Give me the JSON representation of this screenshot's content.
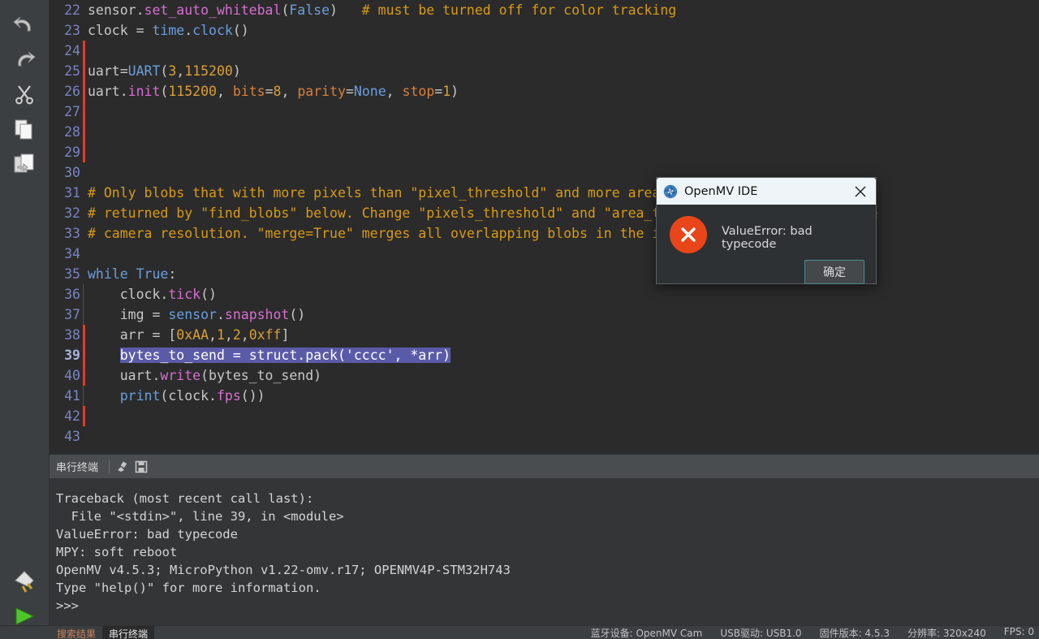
{
  "toolbar": {
    "items": [
      {
        "name": "undo-icon",
        "label": "Undo"
      },
      {
        "name": "redo-icon",
        "label": "Redo"
      },
      {
        "name": "cut-icon",
        "label": "Cut"
      },
      {
        "name": "copy-icon",
        "label": "Copy"
      },
      {
        "name": "paste-icon",
        "label": "Paste"
      }
    ],
    "bottom_items": [
      {
        "name": "connect-plug-icon",
        "label": "Connect"
      },
      {
        "name": "run-play-icon",
        "label": "Run"
      }
    ]
  },
  "editor": {
    "current_line": 39,
    "lines": [
      {
        "n": 22,
        "changed": false,
        "tokens": [
          {
            "t": "sensor",
            "c": "t-plain"
          },
          {
            "t": ".",
            "c": "t-plain"
          },
          {
            "t": "set_auto_whitebal",
            "c": "t-fn"
          },
          {
            "t": "(",
            "c": "t-plain"
          },
          {
            "t": "False",
            "c": "t-kw"
          },
          {
            "t": ")",
            "c": "t-plain"
          },
          {
            "t": "   # must be turned off for color tracking",
            "c": "t-com"
          }
        ]
      },
      {
        "n": 23,
        "changed": false,
        "tokens": [
          {
            "t": "clock = ",
            "c": "t-plain"
          },
          {
            "t": "time",
            "c": "t-builtin"
          },
          {
            "t": ".",
            "c": "t-plain"
          },
          {
            "t": "clock",
            "c": "t-builtin"
          },
          {
            "t": "()",
            "c": "t-plain"
          }
        ]
      },
      {
        "n": 24,
        "changed": true,
        "tokens": []
      },
      {
        "n": 25,
        "changed": true,
        "tokens": [
          {
            "t": "uart=",
            "c": "t-plain"
          },
          {
            "t": "UART",
            "c": "t-builtin"
          },
          {
            "t": "(",
            "c": "t-plain"
          },
          {
            "t": "3",
            "c": "t-num"
          },
          {
            "t": ",",
            "c": "t-plain"
          },
          {
            "t": "115200",
            "c": "t-num"
          },
          {
            "t": ")",
            "c": "t-plain"
          }
        ]
      },
      {
        "n": 26,
        "changed": true,
        "tokens": [
          {
            "t": "uart.",
            "c": "t-plain"
          },
          {
            "t": "init",
            "c": "t-fn"
          },
          {
            "t": "(",
            "c": "t-plain"
          },
          {
            "t": "115200",
            "c": "t-num"
          },
          {
            "t": ", ",
            "c": "t-plain"
          },
          {
            "t": "bits",
            "c": "t-param"
          },
          {
            "t": "=",
            "c": "t-plain"
          },
          {
            "t": "8",
            "c": "t-num"
          },
          {
            "t": ", ",
            "c": "t-plain"
          },
          {
            "t": "parity",
            "c": "t-param"
          },
          {
            "t": "=",
            "c": "t-plain"
          },
          {
            "t": "None",
            "c": "t-kw"
          },
          {
            "t": ", ",
            "c": "t-plain"
          },
          {
            "t": "stop",
            "c": "t-param"
          },
          {
            "t": "=",
            "c": "t-plain"
          },
          {
            "t": "1",
            "c": "t-num"
          },
          {
            "t": ")",
            "c": "t-plain"
          }
        ]
      },
      {
        "n": 27,
        "changed": true,
        "tokens": []
      },
      {
        "n": 28,
        "changed": true,
        "tokens": []
      },
      {
        "n": 29,
        "changed": true,
        "tokens": []
      },
      {
        "n": 30,
        "changed": false,
        "tokens": []
      },
      {
        "n": 31,
        "changed": false,
        "tokens": [
          {
            "t": "# Only blobs that with more pixels than \"pixel_threshold\" and more area than \"area_threshold\" are",
            "c": "t-com"
          }
        ]
      },
      {
        "n": 32,
        "changed": false,
        "tokens": [
          {
            "t": "# returned by \"find_blobs\" below. Change \"pixels_threshold\" and \"area_threshold\" if you change the",
            "c": "t-com"
          }
        ]
      },
      {
        "n": 33,
        "changed": false,
        "tokens": [
          {
            "t": "# camera resolution. \"merge=True\" merges all overlapping blobs in the image.",
            "c": "t-com"
          }
        ]
      },
      {
        "n": 34,
        "changed": false,
        "tokens": []
      },
      {
        "n": 35,
        "changed": false,
        "tokens": [
          {
            "t": "while",
            "c": "t-kw"
          },
          {
            "t": " ",
            "c": "t-plain"
          },
          {
            "t": "True",
            "c": "t-kw"
          },
          {
            "t": ":",
            "c": "t-plain"
          }
        ]
      },
      {
        "n": 36,
        "changed": false,
        "guide": true,
        "tokens": [
          {
            "t": "    clock.",
            "c": "t-plain"
          },
          {
            "t": "tick",
            "c": "t-fn"
          },
          {
            "t": "()",
            "c": "t-plain"
          }
        ]
      },
      {
        "n": 37,
        "changed": false,
        "guide": true,
        "tokens": [
          {
            "t": "    img = ",
            "c": "t-plain"
          },
          {
            "t": "sensor",
            "c": "t-builtin"
          },
          {
            "t": ".",
            "c": "t-plain"
          },
          {
            "t": "snapshot",
            "c": "t-fn"
          },
          {
            "t": "()",
            "c": "t-plain"
          }
        ]
      },
      {
        "n": 38,
        "changed": true,
        "guide": true,
        "tokens": [
          {
            "t": "    arr = [",
            "c": "t-plain"
          },
          {
            "t": "0xAA",
            "c": "t-num"
          },
          {
            "t": ",",
            "c": "t-plain"
          },
          {
            "t": "1",
            "c": "t-num"
          },
          {
            "t": ",",
            "c": "t-plain"
          },
          {
            "t": "2",
            "c": "t-num"
          },
          {
            "t": ",",
            "c": "t-plain"
          },
          {
            "t": "0xff",
            "c": "t-num"
          },
          {
            "t": "]",
            "c": "t-plain"
          }
        ]
      },
      {
        "n": 39,
        "changed": true,
        "guide": true,
        "selected": true,
        "tokens": [
          {
            "t": "    ",
            "c": "t-plain"
          },
          {
            "t": "bytes_to_send = struct.pack('cccc', *arr)",
            "c": "t-sel"
          }
        ]
      },
      {
        "n": 40,
        "changed": true,
        "guide": true,
        "tokens": [
          {
            "t": "    uart.",
            "c": "t-plain"
          },
          {
            "t": "write",
            "c": "t-fn"
          },
          {
            "t": "(bytes_to_send)",
            "c": "t-plain"
          }
        ]
      },
      {
        "n": 41,
        "changed": false,
        "guide": true,
        "tokens": [
          {
            "t": "    ",
            "c": "t-plain"
          },
          {
            "t": "print",
            "c": "t-builtin"
          },
          {
            "t": "(clock.",
            "c": "t-plain"
          },
          {
            "t": "fps",
            "c": "t-fn"
          },
          {
            "t": "())",
            "c": "t-plain"
          }
        ]
      },
      {
        "n": 42,
        "changed": true,
        "tokens": []
      },
      {
        "n": 43,
        "changed": false,
        "tokens": []
      }
    ]
  },
  "terminal": {
    "tab_label": "串行终端",
    "tools": [
      {
        "name": "clear-terminal-icon",
        "label": "Clear"
      },
      {
        "name": "save-terminal-icon",
        "label": "Save"
      }
    ],
    "output": [
      "Traceback (most recent call last):",
      "  File \"<stdin>\", line 39, in <module>",
      "ValueError: bad typecode",
      "MPY: soft reboot",
      "OpenMV v4.5.3; MicroPython v1.22-omv.r17; OPENMV4P-STM32H743",
      "Type \"help()\" for more information.",
      ">>>"
    ]
  },
  "statusbar": {
    "tabs": [
      {
        "label": "搜索结果",
        "active": false
      },
      {
        "label": "串行终端",
        "active": true
      }
    ],
    "right_items": [
      "蓝牙设备: OpenMV Cam",
      "USB驱动: USB1.0",
      "固件版本: 4.5.3",
      "分辨率: 320x240",
      "FPS: 0"
    ]
  },
  "dialog": {
    "title": "OpenMV IDE",
    "logo_icon": "openmv-aperture-icon",
    "close_icon": "close-icon",
    "error_icon": "error-x-icon",
    "message": "ValueError: bad typecode",
    "ok_label": "确定"
  },
  "colors": {
    "editor_bg": "#2b2b2b",
    "panel_bg": "#3c3f41",
    "terminal_bg": "#333536",
    "accent_error": "#e8461a",
    "change_marker": "#e8382c",
    "selection": "#5a5ba8",
    "comment": "#d99a16",
    "keyword": "#6a9fdd"
  }
}
